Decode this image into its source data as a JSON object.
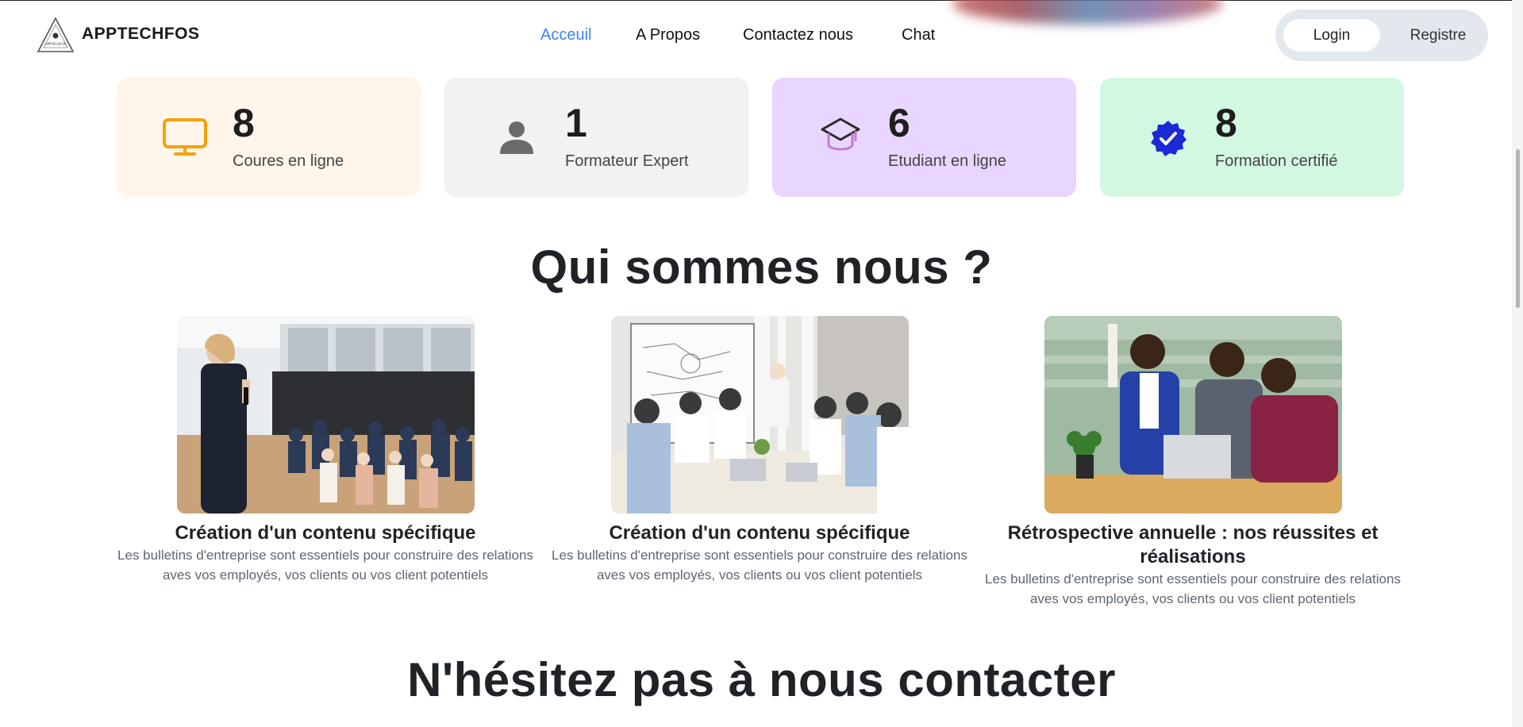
{
  "header": {
    "brand": "APPTECHFOS",
    "logo_text": "APPTECHFOS",
    "nav": [
      {
        "label": "Acceuil",
        "active": true
      },
      {
        "label": "A Propos",
        "active": false
      },
      {
        "label": "Contactez nous",
        "active": false
      },
      {
        "label": "Chat",
        "active": false
      }
    ],
    "login_label": "Login",
    "register_label": "Registre"
  },
  "stats": [
    {
      "value": "8",
      "label": "Coures en ligne",
      "icon": "monitor-icon",
      "bg": "#fff5eb",
      "icon_color": "#f5a10a"
    },
    {
      "value": "1",
      "label": "Formateur Expert",
      "icon": "user-icon",
      "bg": "#f1f2f4",
      "icon_color": "#6b6b6b"
    },
    {
      "value": "6",
      "label": "Etudiant en ligne",
      "icon": "graduation-cap-icon",
      "bg": "#e9d6ff",
      "icon_color": "#c47bd1"
    },
    {
      "value": "8",
      "label": "Formation certifié",
      "icon": "verified-badge-icon",
      "bg": "#d3f8e2",
      "icon_color": "#1a2ad8"
    }
  ],
  "about": {
    "heading": "Qui sommes nous ?",
    "items": [
      {
        "title": "Création d'un contenu spécifique",
        "desc": "Les bulletins d'entreprise sont essentiels pour construire des relations aves vos employés, vos clients ou vos client potentiels",
        "image": "speaker-audience-photo"
      },
      {
        "title": "Création d'un contenu spécifique",
        "desc": "Les bulletins d'entreprise sont essentiels pour construire des relations aves vos employés, vos clients ou vos client potentiels",
        "image": "team-meeting-photo"
      },
      {
        "title": "Rétrospective annuelle : nos réussites et réalisations",
        "desc": "Les bulletins d'entreprise sont essentiels pour construire des relations aves vos employés, vos clients ou vos client potentiels",
        "image": "celebrating-team-photo"
      }
    ]
  },
  "contact": {
    "heading": "N'hésitez pas à nous contacter"
  },
  "colors": {
    "accent": "#3b82f6",
    "pill_bg": "#e3e7ee"
  }
}
